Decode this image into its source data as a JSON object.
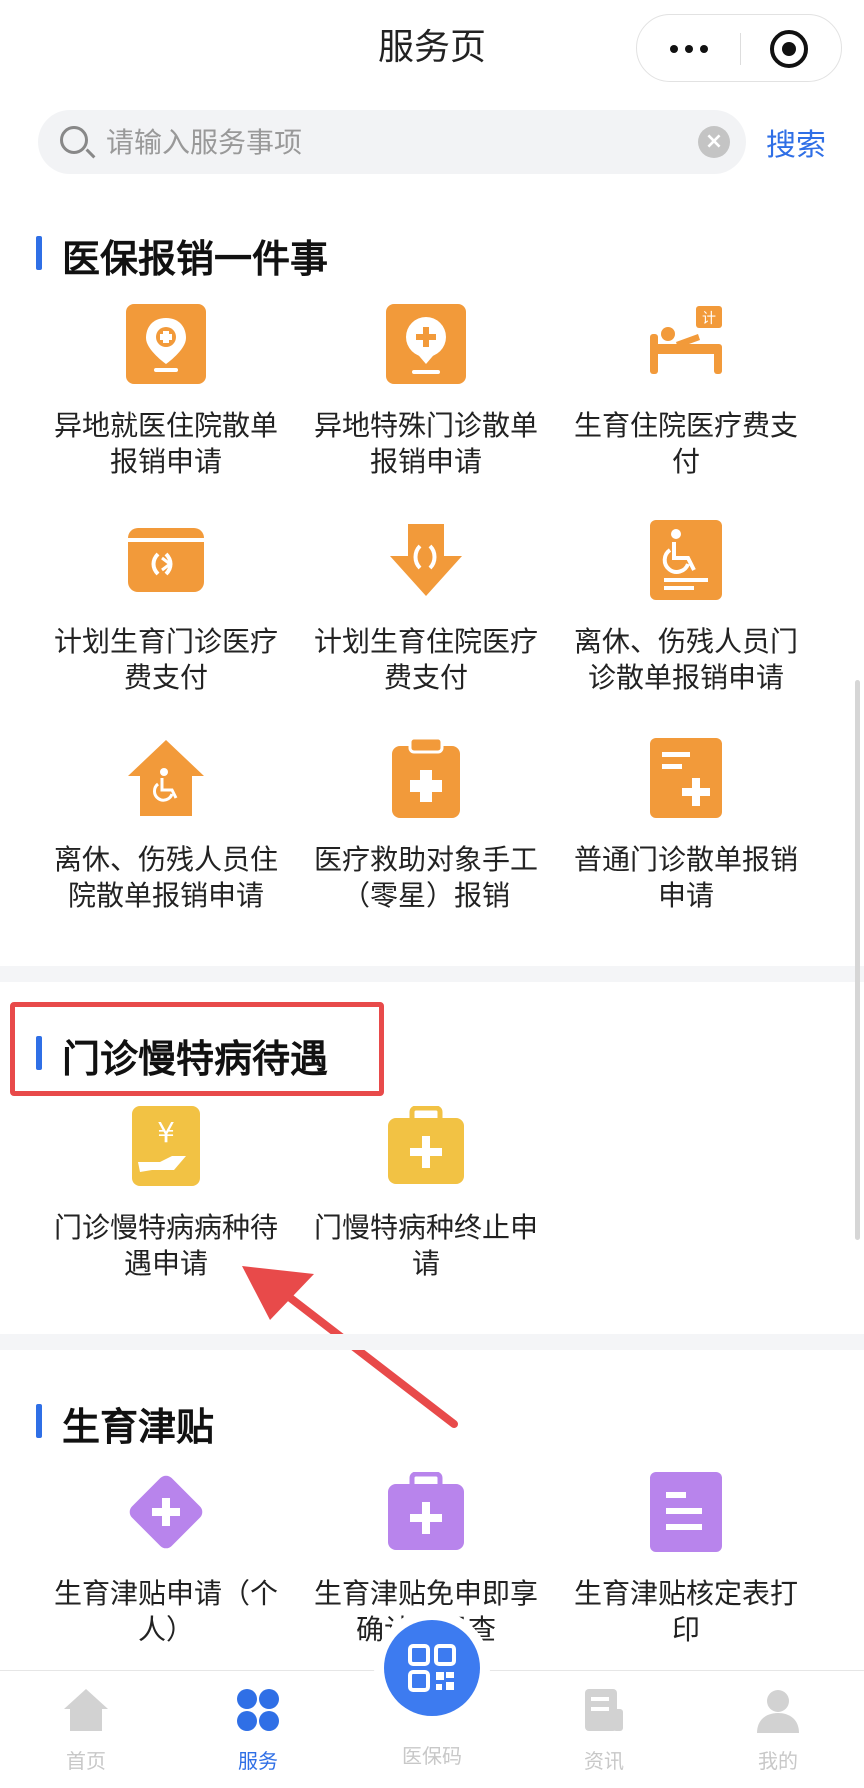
{
  "nav": {
    "title": "服务页"
  },
  "search": {
    "placeholder": "请输入服务事项",
    "button": "搜索"
  },
  "sections": [
    {
      "title": "医保报销一件事",
      "items": [
        {
          "label": "异地就医住院散单报销申请",
          "icon": "map-pin-plus-icon",
          "color": "#f29a3a"
        },
        {
          "label": "异地特殊门诊散单报销申请",
          "icon": "location-plus-icon",
          "color": "#f29a3a"
        },
        {
          "label": "生育住院医疗费支付",
          "icon": "hospital-bed-icon",
          "color": "#f29a3a"
        },
        {
          "label": "计划生育门诊医疗费支付",
          "icon": "card-icon",
          "color": "#f29a3a"
        },
        {
          "label": "计划生育住院医疗费支付",
          "icon": "down-arrow-icon",
          "color": "#f29a3a"
        },
        {
          "label": "离休、伤残人员门诊散单报销申请",
          "icon": "wheelchair-doc-icon",
          "color": "#f29a3a"
        },
        {
          "label": "离休、伤残人员住院散单报销申请",
          "icon": "wheelchair-house-icon",
          "color": "#f29a3a"
        },
        {
          "label": "医疗救助对象手工（零星）报销",
          "icon": "clipboard-plus-icon",
          "color": "#f29a3a"
        },
        {
          "label": "普通门诊散单报销申请",
          "icon": "doc-plus-icon",
          "color": "#f29a3a"
        }
      ]
    },
    {
      "title": "门诊慢特病待遇",
      "items": [
        {
          "label": "门诊慢特病病种待遇申请",
          "icon": "yuan-hand-icon",
          "color": "#f2c244"
        },
        {
          "label": "门慢特病种终止申请",
          "icon": "medkit-icon",
          "color": "#f2c244"
        }
      ]
    },
    {
      "title": "生育津贴",
      "items": [
        {
          "label": "生育津贴申请（个人）",
          "icon": "diamond-plus-icon",
          "color": "#b884ec"
        },
        {
          "label": "生育津贴免申即享确认结果查",
          "icon": "briefcase-plus-icon",
          "color": "#b884ec"
        },
        {
          "label": "生育津贴核定表打印",
          "icon": "document-icon",
          "color": "#b884ec"
        }
      ]
    }
  ],
  "tabbar": {
    "items": [
      {
        "label": "首页",
        "icon": "home-icon",
        "active": false
      },
      {
        "label": "服务",
        "icon": "grid-icon",
        "active": true
      },
      {
        "label": "医保码",
        "icon": "qr-code-icon",
        "active": false
      },
      {
        "label": "资讯",
        "icon": "news-icon",
        "active": false
      },
      {
        "label": "我的",
        "icon": "user-icon",
        "active": false
      }
    ]
  },
  "colors": {
    "accent": "#2f6fe6",
    "orange": "#f29a3a",
    "yellow": "#f2c244",
    "purple": "#b884ec",
    "highlight": "#e84a4a"
  }
}
